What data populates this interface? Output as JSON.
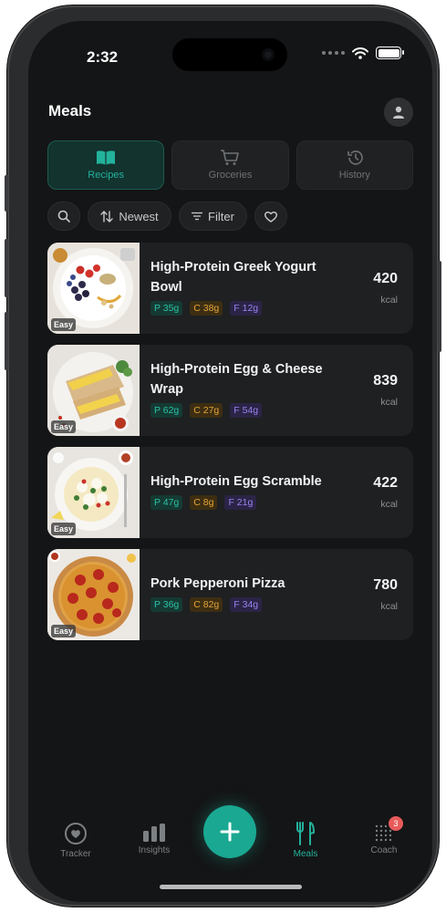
{
  "status": {
    "time": "2:32"
  },
  "header": {
    "title": "Meals"
  },
  "tabs": [
    {
      "label": "Recipes",
      "icon": "book-icon",
      "active": true
    },
    {
      "label": "Groceries",
      "icon": "cart-icon",
      "active": false
    },
    {
      "label": "History",
      "icon": "history-icon",
      "active": false
    }
  ],
  "toolbar": {
    "sort_label": "Newest",
    "filter_label": "Filter"
  },
  "meals": [
    {
      "name": "High-Protein Greek Yogurt Bowl",
      "protein": "P 35g",
      "carbs": "C 38g",
      "fat": "F 12g",
      "kcal": "420",
      "kcal_unit": "kcal",
      "difficulty": "Easy"
    },
    {
      "name": "High-Protein Egg & Cheese Wrap",
      "protein": "P 62g",
      "carbs": "C 27g",
      "fat": "F 54g",
      "kcal": "839",
      "kcal_unit": "kcal",
      "difficulty": "Easy"
    },
    {
      "name": "High-Protein Egg Scramble",
      "protein": "P 47g",
      "carbs": "C 8g",
      "fat": "F 21g",
      "kcal": "422",
      "kcal_unit": "kcal",
      "difficulty": "Easy"
    },
    {
      "name": "Pork Pepperoni Pizza",
      "protein": "P 36g",
      "carbs": "C 82g",
      "fat": "F 34g",
      "kcal": "780",
      "kcal_unit": "kcal",
      "difficulty": "Easy"
    }
  ],
  "nav": {
    "tracker": "Tracker",
    "insights": "Insights",
    "meals": "Meals",
    "coach": "Coach",
    "coach_badge": "3"
  },
  "colors": {
    "accent": "#1aa892",
    "background": "#141516",
    "card": "#1e2022",
    "protein": "#2cc2a6",
    "carbs": "#e3a43a",
    "fat": "#9a82ef",
    "badge": "#e85b5b"
  }
}
